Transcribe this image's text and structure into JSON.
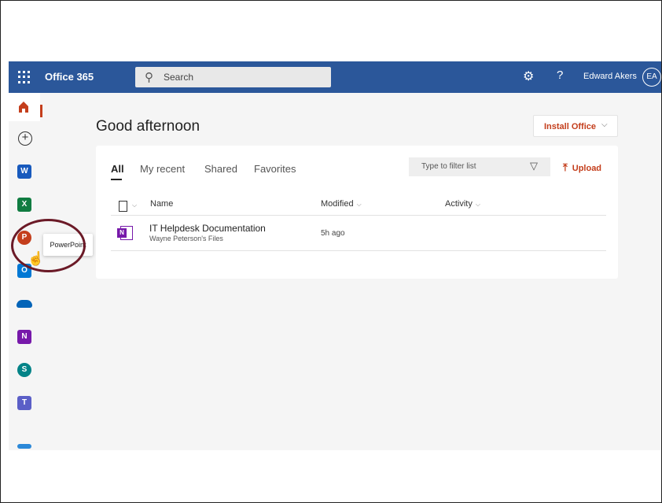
{
  "header": {
    "app_name": "Office 365",
    "search_placeholder": "Search",
    "user_name": "Edward Akers",
    "user_initials": "EA",
    "brand_color": "#2b579a"
  },
  "rail": {
    "items": [
      {
        "name": "Home",
        "icon": "home-icon"
      },
      {
        "name": "Create",
        "icon": "plus-circle-icon"
      },
      {
        "name": "Word",
        "icon": "word-icon",
        "letter": "W",
        "color": "#185abd"
      },
      {
        "name": "Excel",
        "icon": "excel-icon",
        "letter": "X",
        "color": "#107c41"
      },
      {
        "name": "PowerPoint",
        "icon": "powerpoint-icon",
        "letter": "P",
        "color": "#c43e1c"
      },
      {
        "name": "Outlook",
        "icon": "outlook-icon",
        "letter": "O",
        "color": "#0078d4"
      },
      {
        "name": "OneDrive",
        "icon": "onedrive-icon"
      },
      {
        "name": "OneNote",
        "icon": "onenote-icon",
        "letter": "N",
        "color": "#7719aa"
      },
      {
        "name": "SharePoint",
        "icon": "sharepoint-icon",
        "letter": "S",
        "color": "#038387"
      },
      {
        "name": "Teams",
        "icon": "teams-icon",
        "letter": "T",
        "color": "#5b5fc7"
      }
    ],
    "tooltip": "PowerPoint"
  },
  "main": {
    "greeting": "Good afternoon",
    "install_button": "Install Office",
    "tabs": [
      "All",
      "My recent",
      "Shared",
      "Favorites"
    ],
    "filter_placeholder": "Type to filter list",
    "upload_label": "Upload",
    "columns": {
      "name": "Name",
      "modified": "Modified",
      "activity": "Activity"
    },
    "files": [
      {
        "name": "IT Helpdesk Documentation",
        "location": "Wayne Peterson's Files",
        "modified": "5h ago",
        "icon": "onenote-icon"
      }
    ],
    "accent_color": "#c43e1c"
  }
}
